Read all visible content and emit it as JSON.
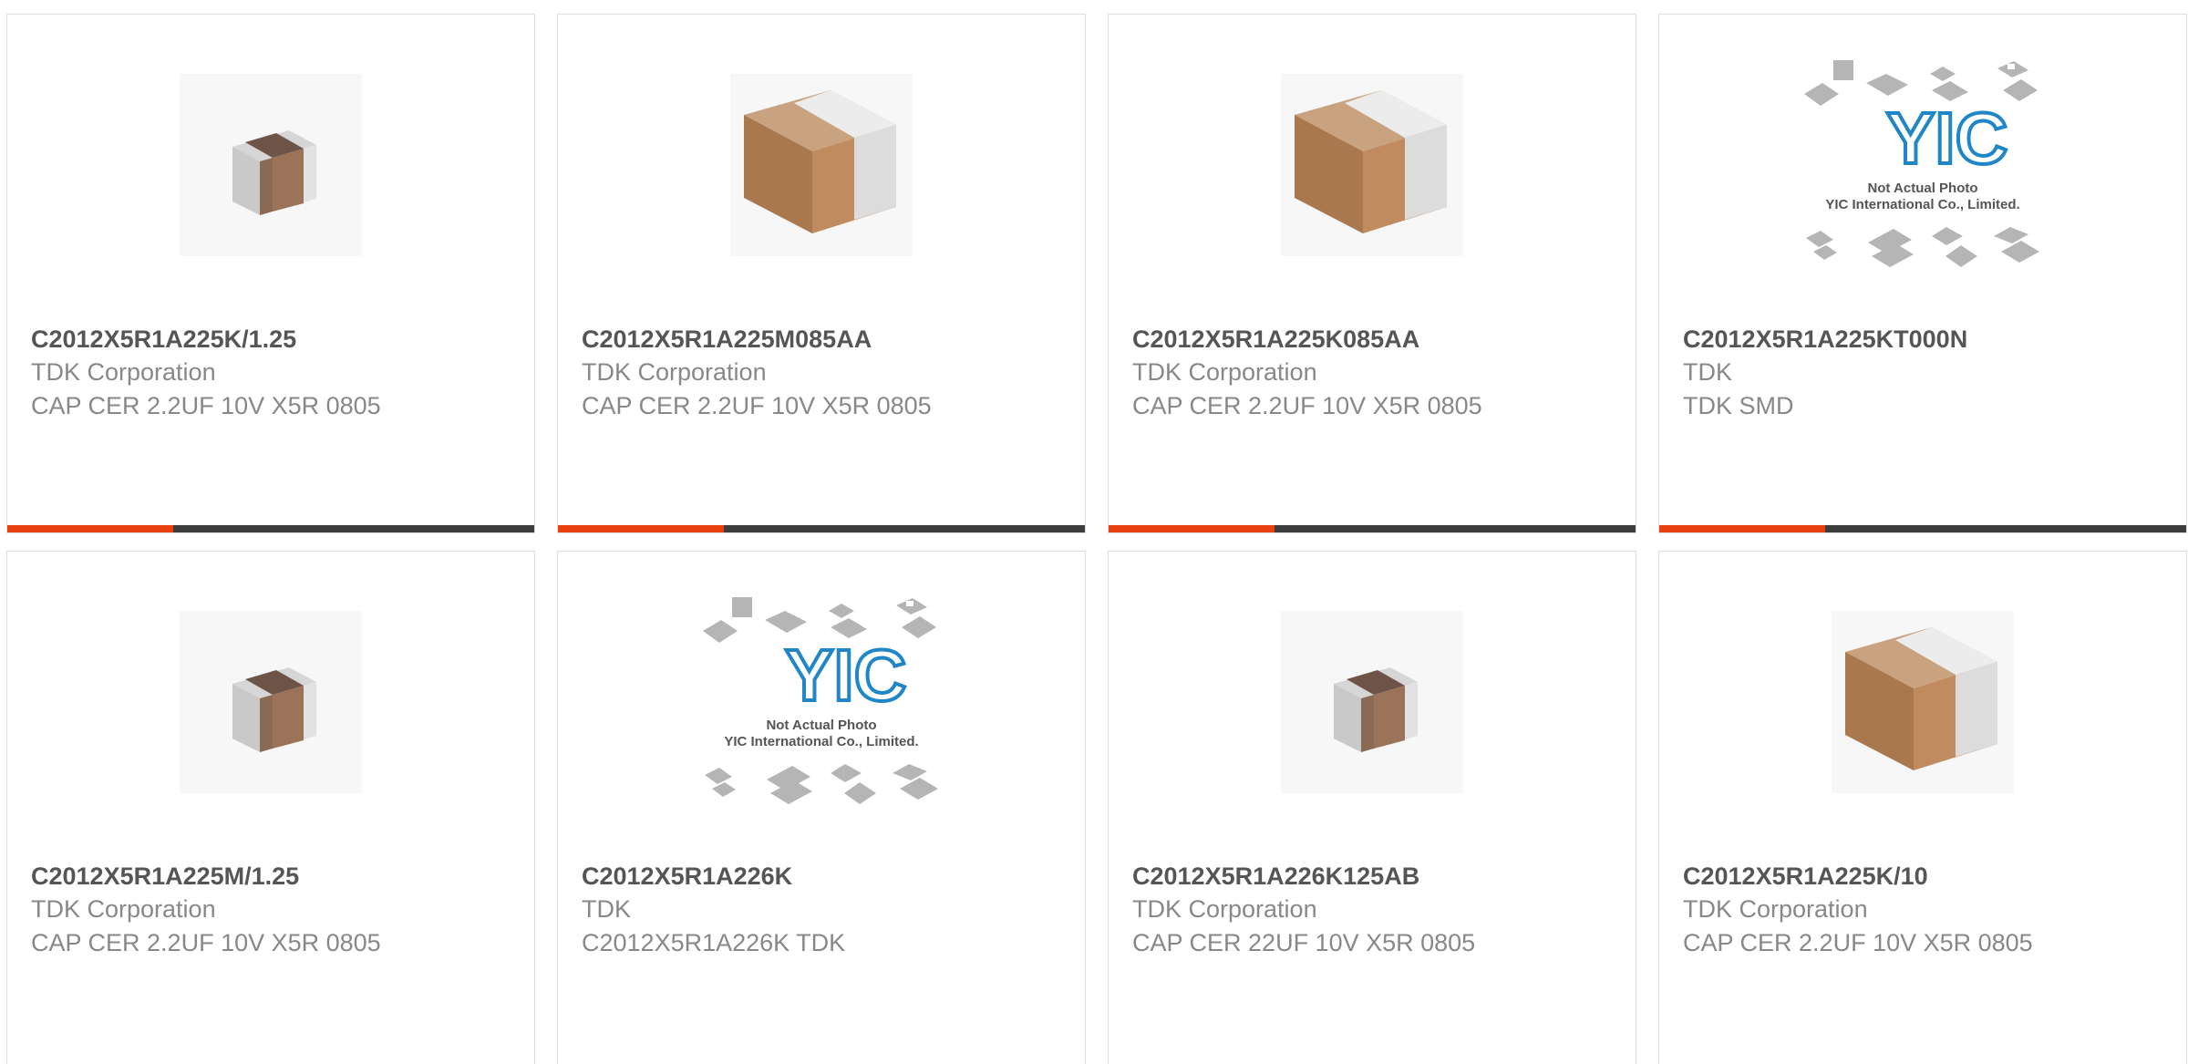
{
  "products": [
    {
      "part": "C2012X5R1A225K/1.25",
      "manufacturer": "TDK Corporation",
      "description": "CAP CER 2.2UF 10V X5R 0805",
      "image": "capacitor-small-icon"
    },
    {
      "part": "C2012X5R1A225M085AA",
      "manufacturer": "TDK Corporation",
      "description": "CAP CER 2.2UF 10V X5R 0805",
      "image": "capacitor-large-icon"
    },
    {
      "part": "C2012X5R1A225K085AA",
      "manufacturer": "TDK Corporation",
      "description": "CAP CER 2.2UF 10V X5R 0805",
      "image": "capacitor-large-icon"
    },
    {
      "part": "C2012X5R1A225KT000N",
      "manufacturer": "TDK",
      "description": "TDK SMD",
      "image": "not-actual-photo-placeholder"
    },
    {
      "part": "C2012X5R1A225M/1.25",
      "manufacturer": "TDK Corporation",
      "description": "CAP CER 2.2UF 10V X5R 0805",
      "image": "capacitor-small-icon"
    },
    {
      "part": "C2012X5R1A226K",
      "manufacturer": "TDK",
      "description": "C2012X5R1A226K TDK",
      "image": "not-actual-photo-placeholder"
    },
    {
      "part": "C2012X5R1A226K125AB",
      "manufacturer": "TDK Corporation",
      "description": "CAP CER 22UF 10V X5R 0805",
      "image": "capacitor-small-icon"
    },
    {
      "part": "C2012X5R1A225K/10",
      "manufacturer": "TDK Corporation",
      "description": "CAP CER 2.2UF 10V X5R 0805",
      "image": "capacitor-large-icon"
    }
  ],
  "placeholder": {
    "logo_text": "YIC",
    "line1": "Not Actual Photo",
    "line2": "YIC International Co., Limited."
  },
  "colors": {
    "accent": "#e8410f",
    "bar": "#3d3d3d",
    "part_text": "#555555",
    "secondary_text": "#888888",
    "capacitor_body": "#b8875e",
    "capacitor_terminal": "#d9d9d9",
    "yic_blue": "#1f86c8"
  }
}
